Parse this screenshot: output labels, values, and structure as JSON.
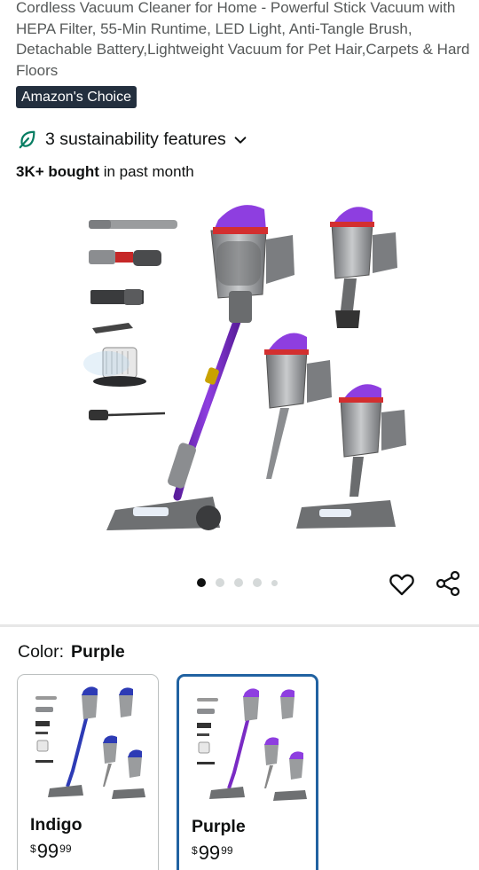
{
  "product": {
    "title": "Cordless Vacuum Cleaner for Home - Powerful Stick Vacuum with HEPA Filter, 55-Min Runtime, LED Light, Anti-Tangle Brush, Detachable Battery,Lightweight Vacuum for Pet Hair,Carpets & Hard Floors",
    "badge": "Amazon's Choice",
    "sustainability_label": "3 sustainability features",
    "bought_count": "3K+ bought",
    "bought_suffix": " in past month"
  },
  "gallery": {
    "image_count": 5,
    "active_index": 0,
    "icons": {
      "favorite": "heart-icon",
      "share": "share-icon"
    },
    "accent_color": "#7a2bc4"
  },
  "color_selector": {
    "label": "Color:",
    "selected": "Purple",
    "options": [
      {
        "name": "Indigo",
        "currency": "$",
        "whole": "99",
        "fraction": "99",
        "color": "#2d3bb5"
      },
      {
        "name": "Purple",
        "currency": "$",
        "whole": "99",
        "fraction": "99",
        "color": "#7a2bc4"
      }
    ]
  },
  "colors": {
    "badge_bg": "#232f3e",
    "selected_border": "#2162a1",
    "leaf_green": "#067d62"
  }
}
